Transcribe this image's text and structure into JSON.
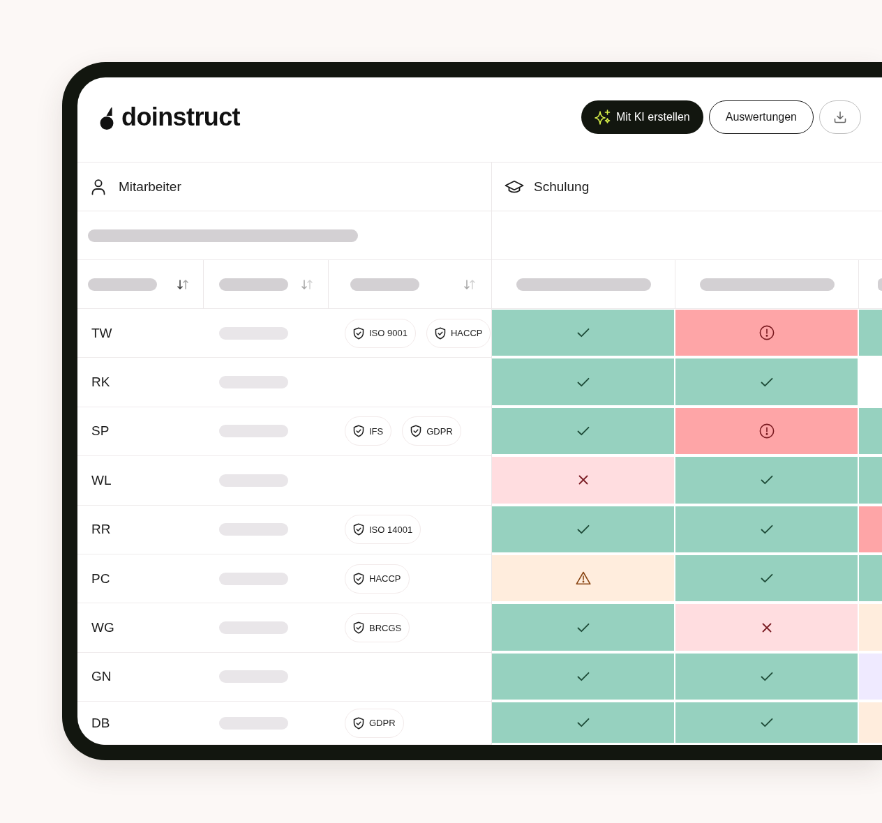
{
  "logo": {
    "text": "doinstruct"
  },
  "actions": [
    {
      "kind": "primary",
      "label": "Mit KI erstellen"
    },
    {
      "kind": "secondary",
      "label": "Auswertungen"
    },
    {
      "kind": "download"
    }
  ],
  "sections": {
    "employees": {
      "title": "Mitarbeiter"
    },
    "training": {
      "title": "Schulung"
    }
  },
  "employee_columns": [
    {
      "sorted": true
    },
    {
      "sorted": false
    },
    {
      "sorted": false
    }
  ],
  "training_columns": [
    {
      "cut_off": false
    },
    {
      "cut_off": false
    },
    {
      "cut_off": true
    }
  ],
  "rows": [
    {
      "initials": "TW",
      "badges": [
        "ISO 9001",
        "HACCP"
      ],
      "cells": [
        {
          "kind": "done"
        },
        {
          "kind": "overdue"
        },
        {
          "kind": "done"
        }
      ]
    },
    {
      "initials": "RK",
      "cells": [
        {
          "kind": "done"
        },
        {
          "kind": "done"
        },
        {
          "kind": "none"
        }
      ]
    },
    {
      "initials": "SP",
      "badges": [
        "IFS",
        "GDPR"
      ],
      "cells": [
        {
          "kind": "done"
        },
        {
          "kind": "overdue"
        },
        {
          "kind": "done"
        }
      ]
    },
    {
      "initials": "WL",
      "cells": [
        {
          "kind": "missing"
        },
        {
          "kind": "done"
        },
        {
          "kind": "done"
        }
      ]
    },
    {
      "initials": "RR",
      "badges": [
        "ISO 14001"
      ],
      "cells": [
        {
          "kind": "done"
        },
        {
          "kind": "done"
        },
        {
          "kind": "overdue"
        }
      ]
    },
    {
      "initials": "PC",
      "badges": [
        "HACCP"
      ],
      "cells": [
        {
          "kind": "warning"
        },
        {
          "kind": "done"
        },
        {
          "kind": "done"
        }
      ]
    },
    {
      "initials": "WG",
      "badges": [
        "BRCGS"
      ],
      "cells": [
        {
          "kind": "done"
        },
        {
          "kind": "missing"
        },
        {
          "kind": "warning"
        }
      ]
    },
    {
      "initials": "GN",
      "cells": [
        {
          "kind": "done"
        },
        {
          "kind": "done"
        },
        {
          "kind": "planned"
        }
      ]
    },
    {
      "initials": "DB",
      "badges": [
        "GDPR"
      ],
      "cells": [
        {
          "kind": "done"
        },
        {
          "kind": "done"
        },
        {
          "kind": "warning"
        }
      ]
    }
  ]
}
